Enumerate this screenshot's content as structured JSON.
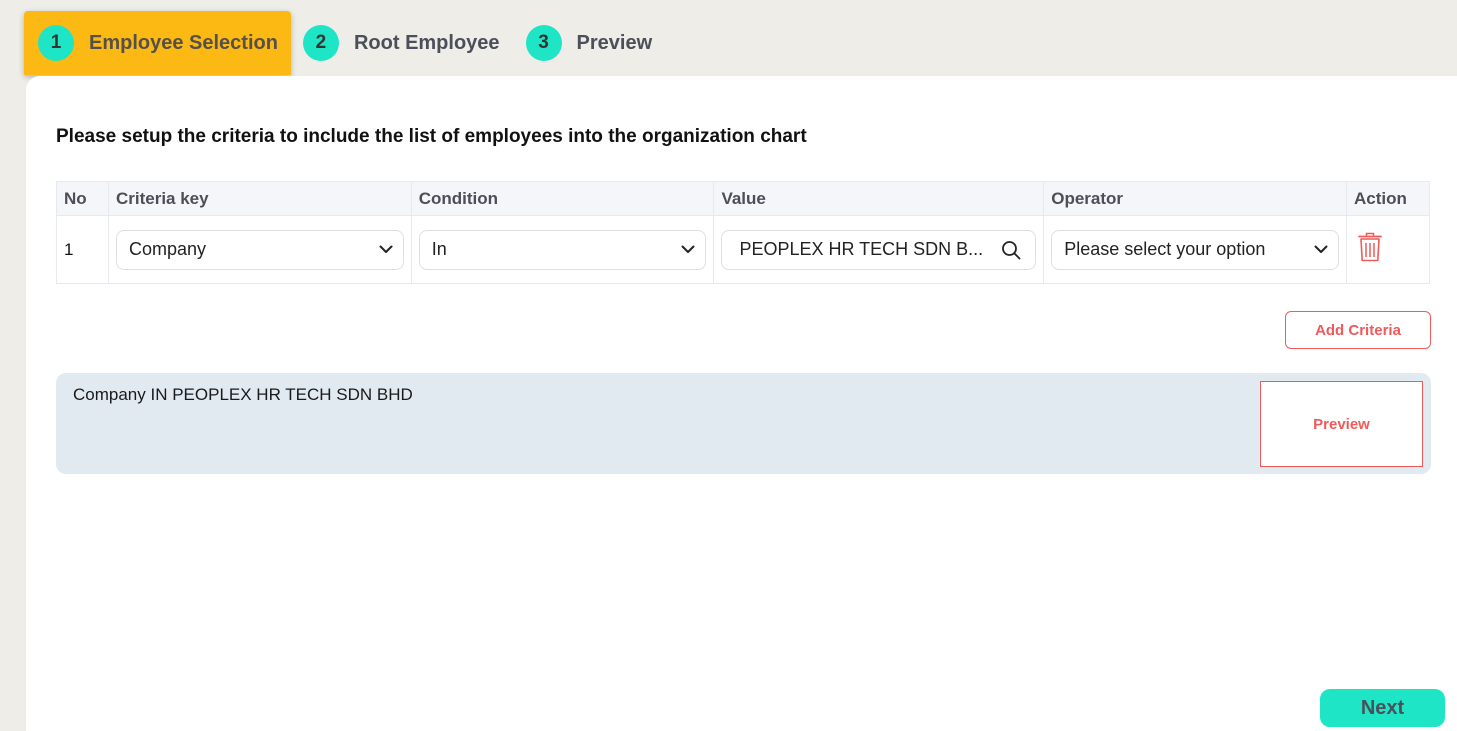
{
  "stepper": {
    "steps": [
      {
        "number": "1",
        "label": "Employee Selection"
      },
      {
        "number": "2",
        "label": "Root Employee"
      },
      {
        "number": "3",
        "label": "Preview"
      }
    ]
  },
  "main": {
    "heading": "Please setup the criteria to include the list of employees into the organization chart",
    "table": {
      "headers": [
        "No",
        "Criteria key",
        "Condition",
        "Value",
        "Operator",
        "Action"
      ],
      "rows": [
        {
          "no": "1",
          "criteria_key": "Company",
          "condition": "In",
          "value": "PEOPLEX HR TECH SDN B...",
          "operator": "Please select your option"
        }
      ]
    },
    "add_criteria_label": "Add Criteria",
    "summary_text": "Company IN PEOPLEX HR TECH SDN BHD",
    "preview_label": "Preview",
    "next_label": "Next"
  },
  "icons": {
    "dropdown": "chevron-down-icon",
    "search": "search-icon",
    "delete": "trash-icon"
  },
  "colors": {
    "active_step": "#fdb913",
    "step_badge": "#1de5c5",
    "accent_red": "#ef5a5a",
    "summary_bg": "#e2eaf1",
    "next_button": "#1de5c5"
  }
}
